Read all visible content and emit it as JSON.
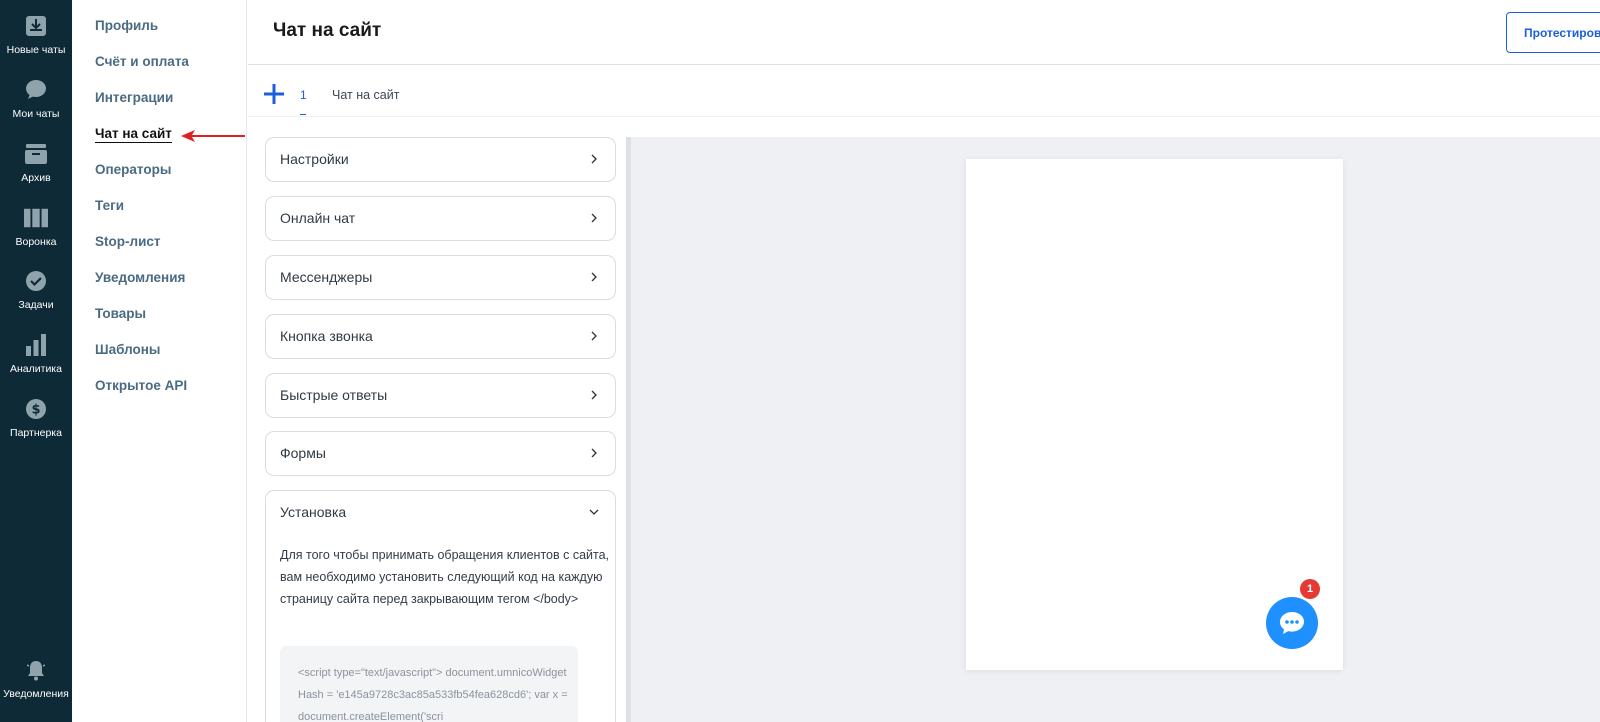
{
  "colors": {
    "rail_bg": "#0d2a36",
    "accent_blue": "#1a5fdc",
    "submenu_text": "#4a6b82",
    "arrow_red": "#e02020",
    "chat_bubble": "#1e90ff",
    "badge_red": "#e53935",
    "preview_bg": "#eef0f4"
  },
  "rail": {
    "items": [
      {
        "label": "Новые чаты",
        "icon": "inbox-download-icon"
      },
      {
        "label": "Мои чаты",
        "icon": "chat-bubble-icon"
      },
      {
        "label": "Архив",
        "icon": "archive-box-icon"
      },
      {
        "label": "Воронка",
        "icon": "kanban-columns-icon"
      },
      {
        "label": "Задачи",
        "icon": "check-circle-icon"
      },
      {
        "label": "Аналитика",
        "icon": "bar-chart-icon"
      },
      {
        "label": "Партнерка",
        "icon": "dollar-circle-icon"
      }
    ],
    "bottom": {
      "label": "Уведомления",
      "icon": "bell-icon"
    }
  },
  "submenu": {
    "items": [
      {
        "label": "Профиль"
      },
      {
        "label": "Счёт и оплата"
      },
      {
        "label": "Интеграции"
      },
      {
        "label": "Чат на сайт",
        "active": true
      },
      {
        "label": "Операторы"
      },
      {
        "label": "Теги"
      },
      {
        "label": "Stop-лист"
      },
      {
        "label": "Уведомления"
      },
      {
        "label": "Товары"
      },
      {
        "label": "Шаблоны"
      },
      {
        "label": "Открытое API"
      }
    ]
  },
  "header": {
    "title": "Чат на сайт",
    "test_button_label": "Протестировать"
  },
  "tabs": {
    "add_icon": "plus-icon",
    "items": [
      {
        "number": "1",
        "name": "Чат на сайт"
      }
    ]
  },
  "panels": [
    {
      "label": "Настройки"
    },
    {
      "label": "Онлайн чат"
    },
    {
      "label": "Мессенджеры"
    },
    {
      "label": "Кнопка звонка"
    },
    {
      "label": "Быстрые ответы"
    },
    {
      "label": "Формы"
    }
  ],
  "install": {
    "label": "Установка",
    "description": "Для того чтобы принимать обращения клиентов с сайта, вам необходимо установить следующий код на каждую страницу сайта перед закрывающим тегом </body>",
    "code": "<script type=\"text/javascript\"> document.umnicoWidgetHash = 'e145a9728c3ac85a533fb54fea628cd6'; var x = document.createElement('scri"
  },
  "preview": {
    "badge_count": "1",
    "chat_icon": "chat-dots-icon"
  }
}
